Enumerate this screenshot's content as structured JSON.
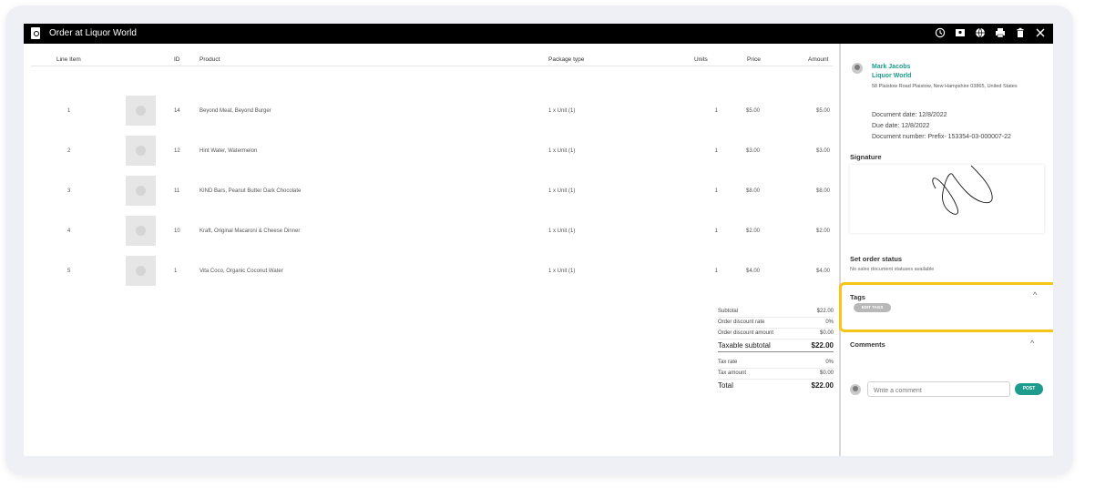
{
  "window": {
    "title": "Order at Liquor World",
    "toolbar_icons": [
      "history-icon",
      "map-icon",
      "globe-icon",
      "print-icon",
      "delete-icon",
      "close-icon"
    ]
  },
  "table": {
    "headers": {
      "line_item": "Line Item",
      "id": "ID",
      "product": "Product",
      "package_type": "Package type",
      "units": "Units",
      "price": "Price",
      "amount": "Amount"
    },
    "rows": [
      {
        "line": "1",
        "id": "14",
        "product": "Beyond Meat, Beyond Burger",
        "package": "1 x Unit (1)",
        "units": "1",
        "price": "$5.00",
        "amount": "$5.00"
      },
      {
        "line": "2",
        "id": "12",
        "product": "Hint Water, Watermelon",
        "package": "1 x Unit (1)",
        "units": "1",
        "price": "$3.00",
        "amount": "$3.00"
      },
      {
        "line": "3",
        "id": "11",
        "product": "KIND Bars, Peanut Butter Dark Chocolate",
        "package": "1 x Unit (1)",
        "units": "1",
        "price": "$8.00",
        "amount": "$8.00"
      },
      {
        "line": "4",
        "id": "10",
        "product": "Kraft, Original Macaroni & Cheese Dinner",
        "package": "1 x Unit (1)",
        "units": "1",
        "price": "$2.00",
        "amount": "$2.00"
      },
      {
        "line": "5",
        "id": "1",
        "product": "Vita Coco, Organic Coconut Water",
        "package": "1 x Unit (1)",
        "units": "1",
        "price": "$4.00",
        "amount": "$4.00"
      }
    ]
  },
  "totals": {
    "subtotal_label": "Subtotal",
    "subtotal": "$22.00",
    "discount_rate_label": "Order discount rate",
    "discount_rate": "0%",
    "discount_amount_label": "Order discount amount",
    "discount_amount": "$0.00",
    "taxable_label": "Taxable subtotal",
    "taxable": "$22.00",
    "tax_rate_label": "Tax rate",
    "tax_rate": "0%",
    "tax_amount_label": "Tax amount",
    "tax_amount": "$0.00",
    "total_label": "Total",
    "total": "$22.00"
  },
  "sidebar": {
    "contact_name": "Mark Jacobs",
    "contact_org": "Liquor World",
    "contact_address": "58 Plaistow Road Plaistow, New Hampshire 03865, United States",
    "document_date": "Document date: 12/8/2022",
    "due_date": "Due date: 12/8/2022",
    "document_number": "Document number: Prefix- 153354-03-000007-22",
    "signature_title": "Signature",
    "status_title": "Set order status",
    "status_text": "No sales document statuses available",
    "tags_title": "Tags",
    "edit_tags_label": "EDIT TAGS",
    "comments_title": "Comments",
    "comment_placeholder": "Write a comment",
    "post_label": "POST"
  },
  "colors": {
    "accent": "#1d9b8c",
    "highlight": "#f5c518",
    "titlebar": "#000000"
  }
}
